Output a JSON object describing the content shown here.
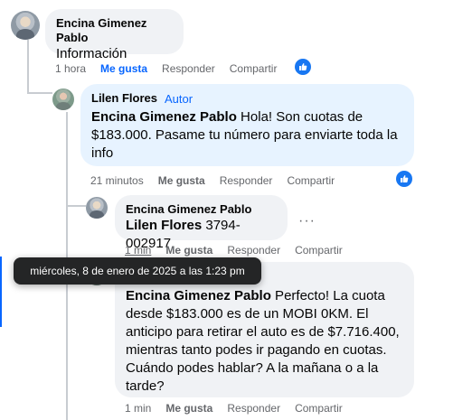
{
  "comments": [
    {
      "author": "Encina Gimenez Pablo",
      "text": "Información",
      "time": "1 hora",
      "like": "Me gusta",
      "reply": "Responder",
      "share": "Compartir"
    },
    {
      "author": "Lilen Flores",
      "badge": "Autor",
      "mention": "Encina Gimenez Pablo",
      "text": " Hola! Son cuotas de $183.000. Pasame tu número para enviarte toda la info",
      "time": "21 minutos",
      "like": "Me gusta",
      "reply": "Responder",
      "share": "Compartir"
    },
    {
      "author": "Encina Gimenez Pablo",
      "mention": "Lilen Flores",
      "text": " 3794-002917",
      "time": "1 min",
      "like": "Me gusta",
      "reply": "Responder",
      "share": "Compartir"
    },
    {
      "author": "Lilen Flores",
      "mention": "Encina Gimenez Pablo",
      "text": " Perfecto! La cuota desde $183.000 es de un MOBI 0KM. El anticipo para retirar el auto es de $7.716.400, mientras tanto podes ir pagando en cuotas. Cuándo podes hablar? A la mañana o a la tarde?",
      "time": "1 min",
      "like": "Me gusta",
      "reply": "Responder",
      "share": "Compartir"
    }
  ],
  "tooltip": "miércoles, 8 de enero de 2025 a las 1:23 pm",
  "more_menu": "···",
  "colors": {
    "accent": "#0866ff",
    "bubble": "#f0f2f5",
    "author_bubble": "#e7f3ff"
  }
}
